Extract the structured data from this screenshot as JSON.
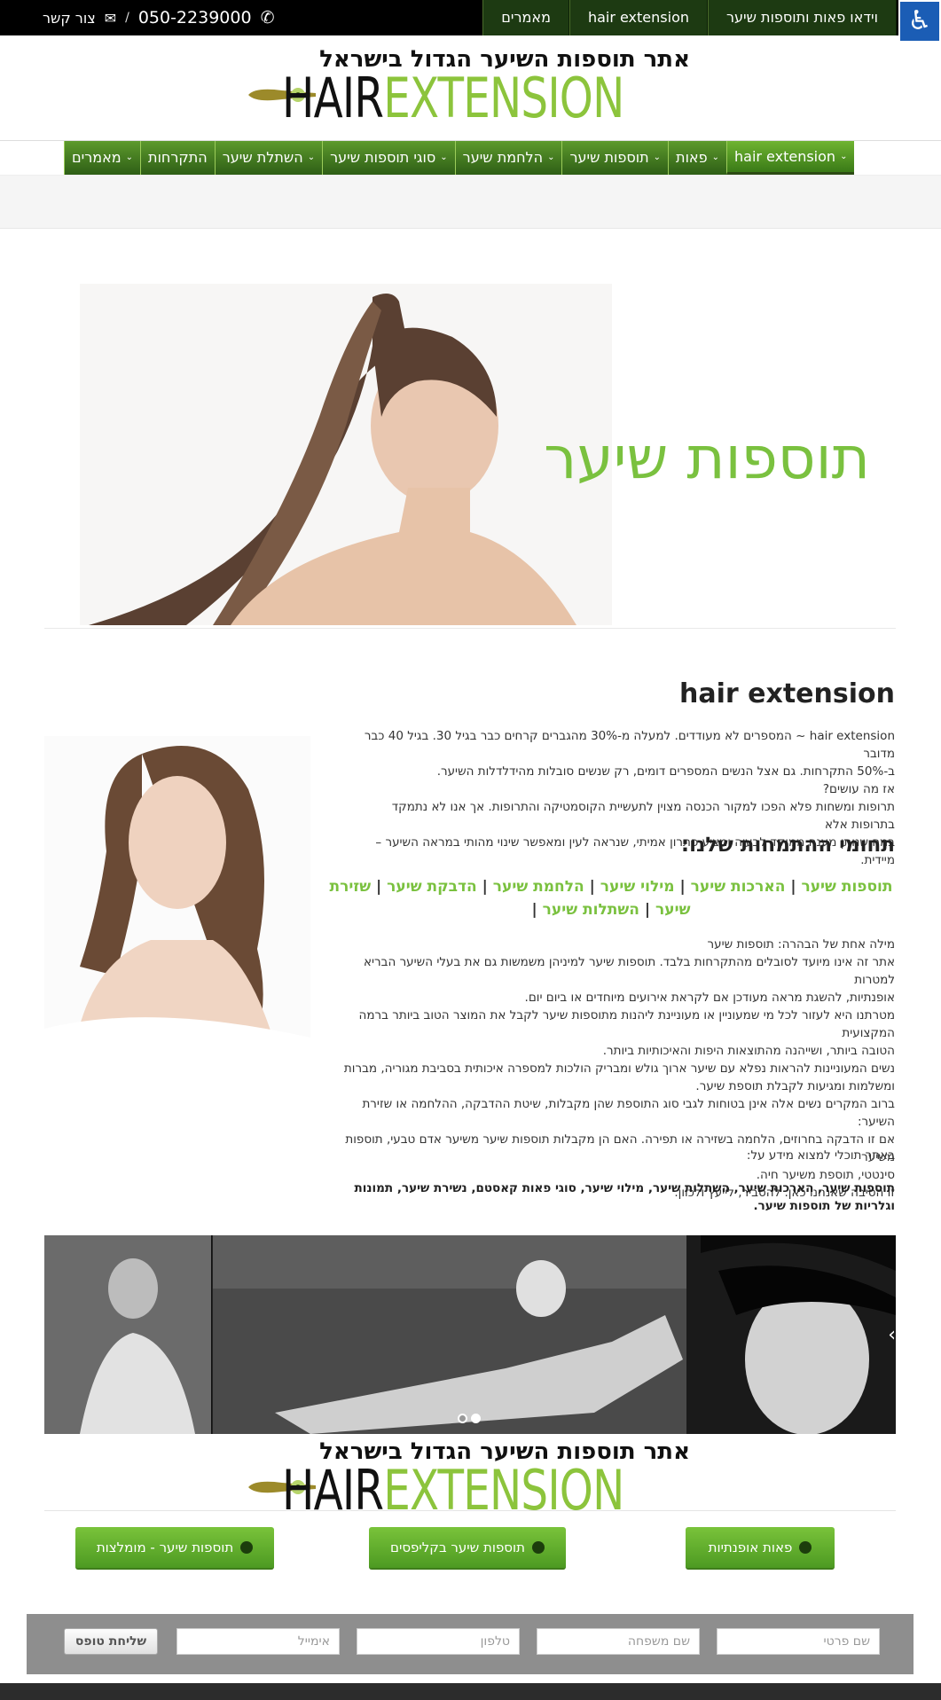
{
  "topbar": {
    "tabs": [
      "וידאו פאות ותוספות שיער",
      "hair extension",
      "מאמרים"
    ],
    "phone": "050-2239000",
    "separator": "/",
    "contact_label": "צור קשר",
    "accessibility_icon": "wheelchair-icon"
  },
  "logo": {
    "tagline": "אתר תוספות השיער הגדול בישראל",
    "word_hair": "HAIR",
    "word_extension": "EXTENSION"
  },
  "nav": {
    "items": [
      {
        "label": "hair extension",
        "dropdown": true,
        "active": true
      },
      {
        "label": "פאות",
        "dropdown": true
      },
      {
        "label": "תוספות שיער",
        "dropdown": true
      },
      {
        "label": "הלחמת שיער",
        "dropdown": true
      },
      {
        "label": "סוגי תוספות שיער",
        "dropdown": true
      },
      {
        "label": "השתלת שיער",
        "dropdown": true
      },
      {
        "label": "התקרחות",
        "dropdown": false
      },
      {
        "label": "מאמרים",
        "dropdown": true
      }
    ]
  },
  "hero": {
    "title": "תוספות שיער"
  },
  "content": {
    "heading": "hair extension",
    "intro": [
      "hair extension ~ המספרים לא מעודדים. למעלה מ-30% מהגברים קרחים כבר בגיל 30. בגיל 40 כבר מדובר",
      "ב-50% התקרחות. גם אצל הנשים המספרים דומים, רק שנשים סובלות מהידלדלות השיער.",
      "אז מה עושים?",
      "תרופות ומשחות פלא הפכו למקור הכנסה מצוין לתעשיית הקוסמטיקה והתרופות. אך אנו לא נתמקד בתרופות אלא",
      "במה שנותן מענה ממוקד לבעיה ומציע פתרון אמיתי, שנראה לעין ומאפשר שינוי מהותי במראה השיער – מיידית."
    ],
    "specialties_heading": "תחומי ההתמחות שלנו:",
    "specialty_links": [
      "תוספות שיער",
      "הארכות שיער",
      "מילוי שיער",
      "הלחמת שיער",
      "הדבקת שיער",
      "שזירת שיער",
      "השתלות שיער"
    ],
    "link_separator": "|",
    "body": [
      "מילה אחת של הבהרה: תוספות שיער",
      "אתר זה אינו מיועד לסובלים מהתקרחות בלבד. תוספות שיער למיניהן משמשות גם את בעלי השיער הבריא למטרות",
      "אופנתיות, להשגת מראה מעודכן אם לקראת אירועים מיוחדים או ביום יום.",
      "מטרתנו היא לעזור לכל מי שמעוניין או מעוניינת ליהנות מתוספות שיער לקבל את המוצר הטוב ביותר ברמה המקצועית",
      "הטובה ביותר, ושייהנה מהתוצאות היפות והאיכותיות ביותר.",
      "נשים המעוניינות להראות נפלא עם שיער ארוך גולש ומבריק הולכות למספרה איכותית בסביבת מגוריה, מברות",
      "ומשלמות ומגיעות לקבלת תוספת שיער.",
      "ברוב המקרים נשים אלה אינן בטוחות לגבי סוג התוספת שהן מקבלות, שיטת ההדבקה, ההלחמה או שזירת השיער:",
      "אם זו הדבקה בחרוזים, הלחמה בשזירה או תפירה. האם הן מקבלות תוספות שיער משיער אדם טבעי, תוספות משיער",
      "סינטטי, תוספת משיער חיה.",
      "זו הסיבה שאנחנו כאן. להסביר, לייעץ ולכוון."
    ],
    "info_line": "באתר תוכלי למצוא מידע על:",
    "bold_line": "תוספות שיער, הארכות שיער, השתלות שיער, מילוי שיער, סוגי פאות קאסטם, נשירת שיער, תמונות וגלריות של תוספות שיער."
  },
  "slider": {
    "dots": 2,
    "active_dot": 1,
    "arrow_icon": "chevron-right-icon"
  },
  "buttons": [
    {
      "label": "פאות אופנתיות"
    },
    {
      "label": "תוספות שיער בקליפסים"
    },
    {
      "label": "תוספות שיער - מומלצות"
    }
  ],
  "form": {
    "first_name_placeholder": "שם פרטי",
    "last_name_placeholder": "שם משפחה",
    "phone_placeholder": "טלפון",
    "email_placeholder": "אימייל",
    "submit_label": "שליחת טופס"
  },
  "colors": {
    "accent": "#7ac13f",
    "nav_dark": "#2e5e16",
    "topbar": "#000000"
  }
}
